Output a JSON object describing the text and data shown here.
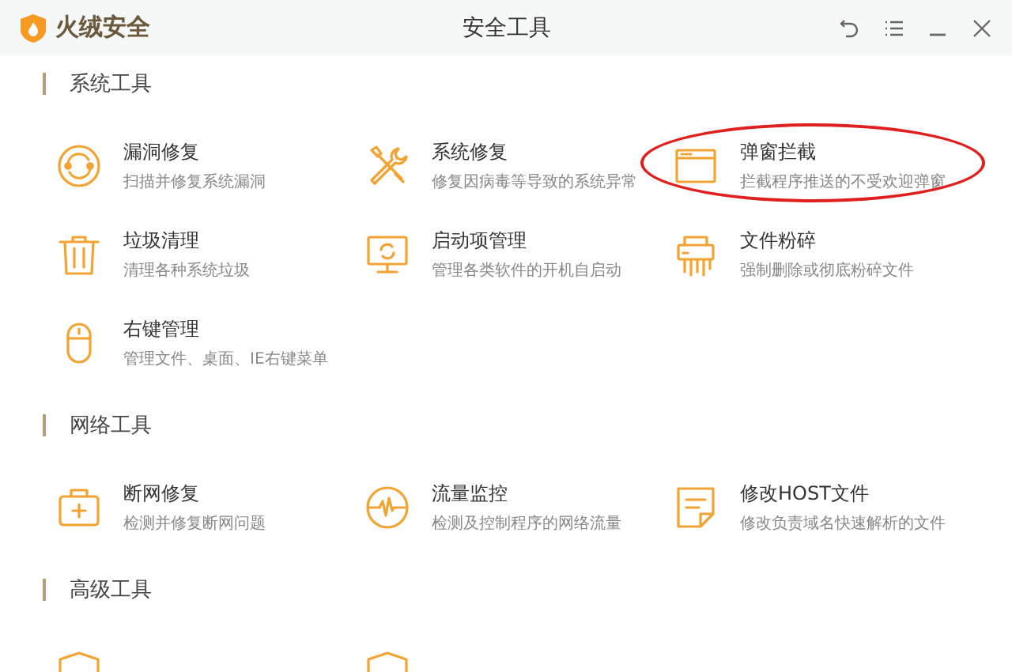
{
  "window": {
    "app_name": "火绒安全",
    "title": "安全工具"
  },
  "title_buttons": [
    {
      "kind": "back"
    },
    {
      "kind": "menu"
    },
    {
      "kind": "minimize"
    },
    {
      "kind": "close"
    }
  ],
  "sections": [
    {
      "title": "系统工具",
      "tools": [
        {
          "kind": "circle-refresh",
          "name": "漏洞修复",
          "description": "扫描并修复系统漏洞",
          "highlighted": false
        },
        {
          "kind": "tools",
          "name": "系统修复",
          "description": "修复因病毒等导致的系统异常",
          "highlighted": false
        },
        {
          "kind": "window",
          "name": "弹窗拦截",
          "description": "拦截程序推送的不受欢迎弹窗",
          "highlighted": true
        },
        {
          "kind": "trash",
          "name": "垃圾清理",
          "description": "清理各种系统垃圾",
          "highlighted": false
        },
        {
          "kind": "monitor",
          "name": "启动项管理",
          "description": "管理各类软件的开机自启动",
          "highlighted": false
        },
        {
          "kind": "shredder",
          "name": "文件粉碎",
          "description": "强制删除或彻底粉碎文件",
          "highlighted": false
        },
        {
          "kind": "mouse",
          "name": "右键管理",
          "description": "管理文件、桌面、IE右键菜单",
          "highlighted": false
        }
      ]
    },
    {
      "title": "网络工具",
      "tools": [
        {
          "kind": "kit",
          "name": "断网修复",
          "description": "检测并修复断网问题",
          "highlighted": false
        },
        {
          "kind": "pulse",
          "name": "流量监控",
          "description": "检测及控制程序的网络流量",
          "highlighted": false
        },
        {
          "kind": "note",
          "name": "修改HOST文件",
          "description": "修改负责域名快速解析的文件",
          "highlighted": false
        }
      ]
    },
    {
      "title": "高级工具",
      "tools": [
        {
          "kind": "shield"
        },
        {
          "kind": "shield"
        }
      ]
    }
  ]
}
